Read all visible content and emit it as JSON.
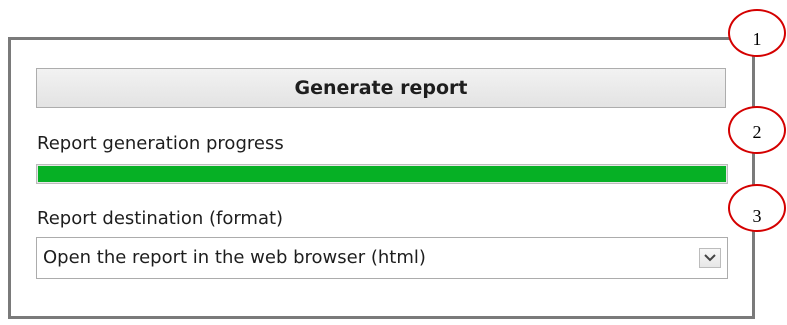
{
  "panel": {
    "generate_button": "Generate report",
    "progress_label": "Report generation progress",
    "progress_value": 1.0,
    "progress_color": "#06b025",
    "destination_label": "Report destination (format)",
    "destination_value": "Open the report in the web browser (html)",
    "dropdown_icon": "chevron-down-icon"
  },
  "callouts": [
    {
      "number": "1",
      "color": "#d40000"
    },
    {
      "number": "2",
      "color": "#d40000"
    },
    {
      "number": "3",
      "color": "#d40000"
    }
  ]
}
